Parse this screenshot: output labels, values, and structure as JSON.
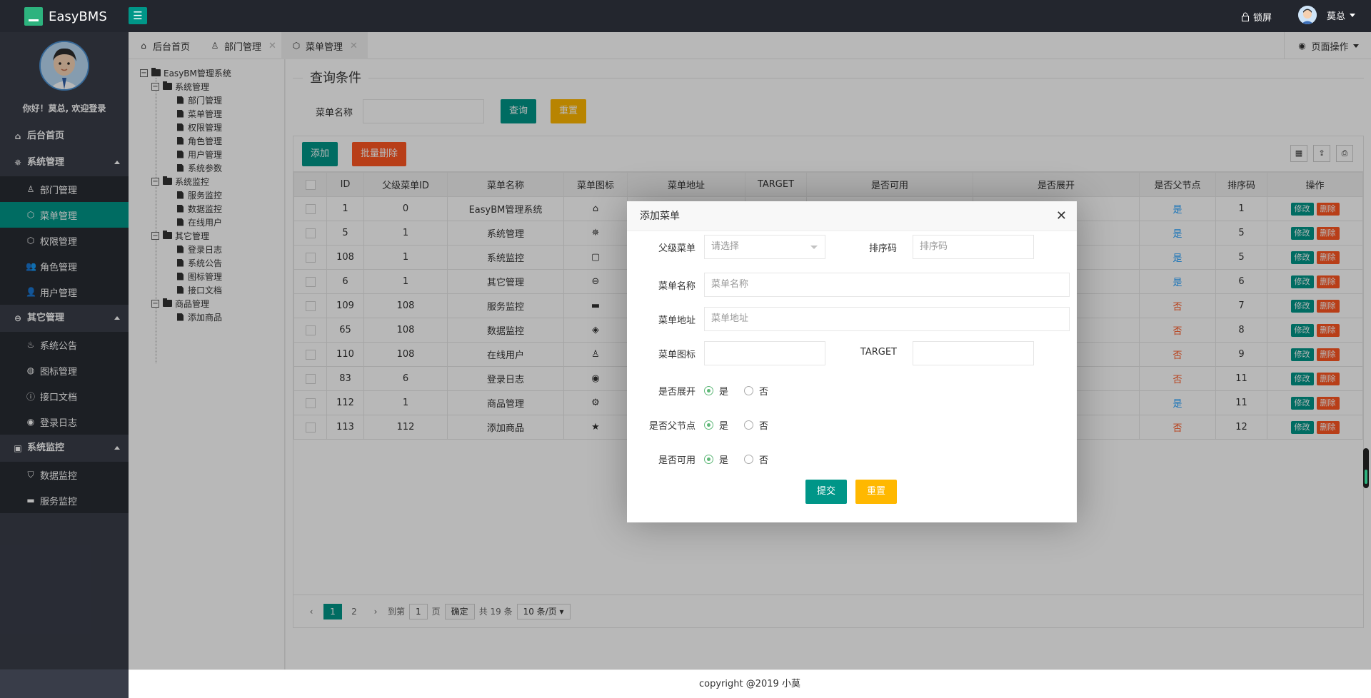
{
  "app": {
    "name": "EasyBMS",
    "menu_toggle_icon": "☰",
    "lock_label": "锁屏",
    "user_name": "莫总"
  },
  "sidebar": {
    "welcome": "你好！莫总, 欢迎登录",
    "home": "后台首页",
    "groups": [
      {
        "label": "系统管理",
        "items": [
          "部门管理",
          "菜单管理",
          "权限管理",
          "角色管理",
          "用户管理"
        ]
      },
      {
        "label": "其它管理",
        "items": [
          "系统公告",
          "图标管理",
          "接口文档",
          "登录日志"
        ]
      },
      {
        "label": "系统监控",
        "items": [
          "数据监控",
          "服务监控"
        ]
      }
    ]
  },
  "tabs": [
    {
      "label": "后台首页"
    },
    {
      "label": "部门管理"
    },
    {
      "label": "菜单管理"
    }
  ],
  "page_ops_label": "页面操作",
  "tree": {
    "root": "EasyBM管理系统",
    "nodes": [
      {
        "label": "系统管理",
        "children": [
          "部门管理",
          "菜单管理",
          "权限管理",
          "角色管理",
          "用户管理",
          "系统参数"
        ]
      },
      {
        "label": "系统监控",
        "children": [
          "服务监控",
          "数据监控",
          "在线用户"
        ]
      },
      {
        "label": "其它管理",
        "children": [
          "登录日志",
          "系统公告",
          "图标管理",
          "接口文档"
        ]
      },
      {
        "label": "商品管理",
        "children": [
          "添加商品"
        ]
      }
    ]
  },
  "query": {
    "legend": "查询条件",
    "menu_name_label": "菜单名称",
    "search_btn": "查询",
    "reset_btn": "重置"
  },
  "toolbar": {
    "add_btn": "添加",
    "batch_delete_btn": "批量删除"
  },
  "table": {
    "headers": [
      "ID",
      "父级菜单ID",
      "菜单名称",
      "菜单图标",
      "菜单地址",
      "TARGET",
      "是否可用",
      "是否展开",
      "是否父节点",
      "排序码",
      "操作"
    ],
    "rows": [
      {
        "id": "1",
        "pid": "0",
        "name": "EasyBM管理系统",
        "icon": "⌂",
        "parent": "是",
        "sort": "1"
      },
      {
        "id": "5",
        "pid": "1",
        "name": "系统管理",
        "icon": "✵",
        "parent": "是",
        "sort": "5"
      },
      {
        "id": "108",
        "pid": "1",
        "name": "系统监控",
        "icon": "▢",
        "parent": "是",
        "sort": "5"
      },
      {
        "id": "6",
        "pid": "1",
        "name": "其它管理",
        "icon": "⊖",
        "parent": "是",
        "sort": "6"
      },
      {
        "id": "109",
        "pid": "108",
        "name": "服务监控",
        "icon": "▬",
        "parent": "否",
        "sort": "7"
      },
      {
        "id": "65",
        "pid": "108",
        "name": "数据监控",
        "icon": "◈",
        "parent": "否",
        "sort": "8"
      },
      {
        "id": "110",
        "pid": "108",
        "name": "在线用户",
        "icon": "♙",
        "parent": "否",
        "sort": "9"
      },
      {
        "id": "83",
        "pid": "6",
        "name": "登录日志",
        "icon": "◉",
        "parent": "否",
        "sort": "11"
      },
      {
        "id": "112",
        "pid": "1",
        "name": "商品管理",
        "icon": "⚙",
        "parent": "是",
        "sort": "11"
      },
      {
        "id": "113",
        "pid": "112",
        "name": "添加商品",
        "icon": "★",
        "parent": "否",
        "sort": "12"
      }
    ],
    "edit_btn": "修改",
    "delete_btn": "删除"
  },
  "pager": {
    "pages": [
      "1",
      "2"
    ],
    "goto_label": "到第",
    "goto_value": "1",
    "page_unit": "页",
    "confirm": "确定",
    "total": "共 19 条",
    "page_size": "10 条/页"
  },
  "modal": {
    "title": "添加菜单",
    "parent_label": "父级菜单",
    "parent_placeholder": "请选择",
    "sort_label": "排序码",
    "sort_placeholder": "排序码",
    "name_label": "菜单名称",
    "name_placeholder": "菜单名称",
    "url_label": "菜单地址",
    "url_placeholder": "菜单地址",
    "icon_label": "菜单图标",
    "target_label": "TARGET",
    "expand_label": "是否展开",
    "isparent_label": "是否父节点",
    "enabled_label": "是否可用",
    "yes": "是",
    "no": "否",
    "submit": "提交",
    "reset": "重置"
  },
  "footer": "copyright @2019 小莫",
  "colors": {
    "teal": "#009688",
    "yellow": "#ffb800",
    "red": "#ff5722",
    "blue": "#1e9fff",
    "header": "#23262e",
    "sidebar": "#393d49"
  }
}
